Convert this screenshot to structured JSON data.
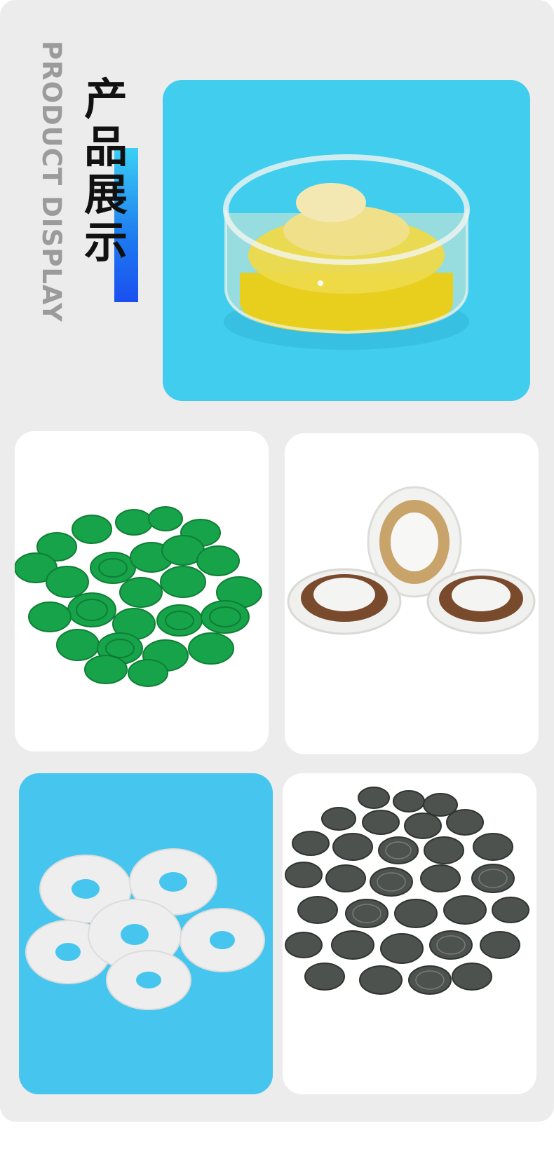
{
  "heading": {
    "title_en": "PRODUCT DISPLAY",
    "title_cn": [
      "产",
      "品",
      "展",
      "示"
    ]
  },
  "photos": [
    {
      "subject": "yellow-bearing-in-clear-case"
    },
    {
      "subject": "green-plastic-caps"
    },
    {
      "subject": "white-ceramic-bearings"
    },
    {
      "subject": "white-plastic-washers"
    },
    {
      "subject": "gray-plastic-caps"
    }
  ],
  "colors": {
    "accent_blue": "#1d78f0",
    "photo_bg_blue": "#40cdee",
    "panel_bg": "#ececec"
  }
}
